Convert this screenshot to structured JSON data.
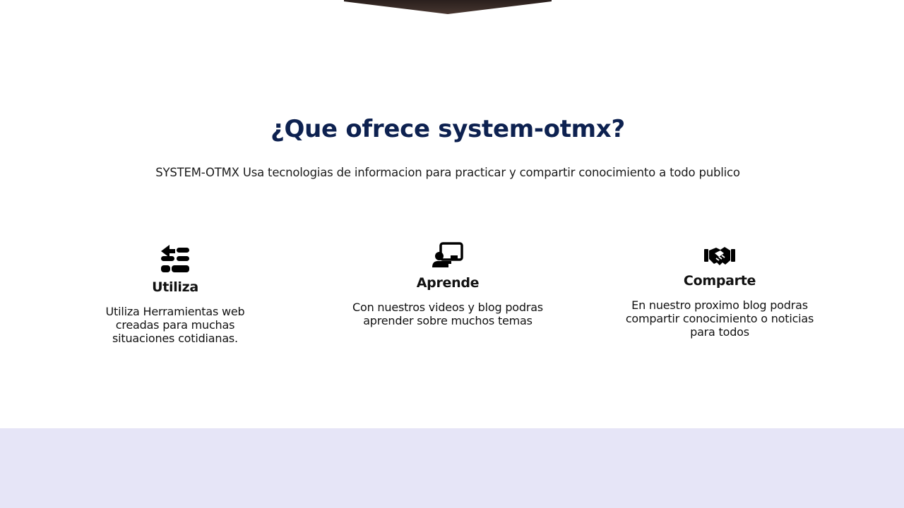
{
  "section": {
    "title": "¿Que ofrece system-otmx?",
    "subtitle": "SYSTEM-OTMX Usa tecnologias de informacion para practicar y compartir conocimiento a todo publico"
  },
  "features": [
    {
      "icon": "tools-icon",
      "title": "Utiliza",
      "text": "Utiliza Herramientas web creadas para muchas situaciones cotidianas."
    },
    {
      "icon": "chalkboard-teacher-icon",
      "title": "Aprende",
      "text": "Con nuestros videos y blog podras aprender sobre muchos temas"
    },
    {
      "icon": "handshake-icon",
      "title": "Comparte",
      "text": "En nuestro proximo blog podras compartir conocimiento o noticias para todos"
    }
  ],
  "colors": {
    "title": "#0d2150",
    "text": "#111111",
    "footer_band": "#e6e5f7"
  }
}
